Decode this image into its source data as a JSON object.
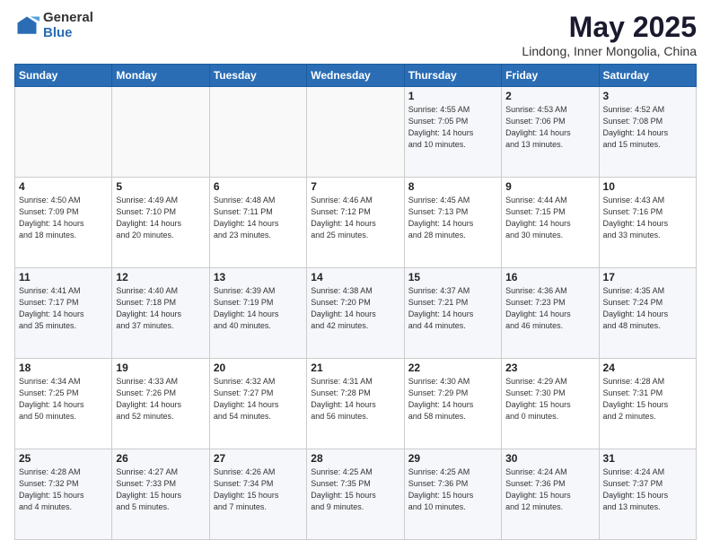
{
  "header": {
    "logo_general": "General",
    "logo_blue": "Blue",
    "month_title": "May 2025",
    "subtitle": "Lindong, Inner Mongolia, China"
  },
  "weekdays": [
    "Sunday",
    "Monday",
    "Tuesday",
    "Wednesday",
    "Thursday",
    "Friday",
    "Saturday"
  ],
  "weeks": [
    [
      {
        "day": "",
        "info": ""
      },
      {
        "day": "",
        "info": ""
      },
      {
        "day": "",
        "info": ""
      },
      {
        "day": "",
        "info": ""
      },
      {
        "day": "1",
        "info": "Sunrise: 4:55 AM\nSunset: 7:05 PM\nDaylight: 14 hours\nand 10 minutes."
      },
      {
        "day": "2",
        "info": "Sunrise: 4:53 AM\nSunset: 7:06 PM\nDaylight: 14 hours\nand 13 minutes."
      },
      {
        "day": "3",
        "info": "Sunrise: 4:52 AM\nSunset: 7:08 PM\nDaylight: 14 hours\nand 15 minutes."
      }
    ],
    [
      {
        "day": "4",
        "info": "Sunrise: 4:50 AM\nSunset: 7:09 PM\nDaylight: 14 hours\nand 18 minutes."
      },
      {
        "day": "5",
        "info": "Sunrise: 4:49 AM\nSunset: 7:10 PM\nDaylight: 14 hours\nand 20 minutes."
      },
      {
        "day": "6",
        "info": "Sunrise: 4:48 AM\nSunset: 7:11 PM\nDaylight: 14 hours\nand 23 minutes."
      },
      {
        "day": "7",
        "info": "Sunrise: 4:46 AM\nSunset: 7:12 PM\nDaylight: 14 hours\nand 25 minutes."
      },
      {
        "day": "8",
        "info": "Sunrise: 4:45 AM\nSunset: 7:13 PM\nDaylight: 14 hours\nand 28 minutes."
      },
      {
        "day": "9",
        "info": "Sunrise: 4:44 AM\nSunset: 7:15 PM\nDaylight: 14 hours\nand 30 minutes."
      },
      {
        "day": "10",
        "info": "Sunrise: 4:43 AM\nSunset: 7:16 PM\nDaylight: 14 hours\nand 33 minutes."
      }
    ],
    [
      {
        "day": "11",
        "info": "Sunrise: 4:41 AM\nSunset: 7:17 PM\nDaylight: 14 hours\nand 35 minutes."
      },
      {
        "day": "12",
        "info": "Sunrise: 4:40 AM\nSunset: 7:18 PM\nDaylight: 14 hours\nand 37 minutes."
      },
      {
        "day": "13",
        "info": "Sunrise: 4:39 AM\nSunset: 7:19 PM\nDaylight: 14 hours\nand 40 minutes."
      },
      {
        "day": "14",
        "info": "Sunrise: 4:38 AM\nSunset: 7:20 PM\nDaylight: 14 hours\nand 42 minutes."
      },
      {
        "day": "15",
        "info": "Sunrise: 4:37 AM\nSunset: 7:21 PM\nDaylight: 14 hours\nand 44 minutes."
      },
      {
        "day": "16",
        "info": "Sunrise: 4:36 AM\nSunset: 7:23 PM\nDaylight: 14 hours\nand 46 minutes."
      },
      {
        "day": "17",
        "info": "Sunrise: 4:35 AM\nSunset: 7:24 PM\nDaylight: 14 hours\nand 48 minutes."
      }
    ],
    [
      {
        "day": "18",
        "info": "Sunrise: 4:34 AM\nSunset: 7:25 PM\nDaylight: 14 hours\nand 50 minutes."
      },
      {
        "day": "19",
        "info": "Sunrise: 4:33 AM\nSunset: 7:26 PM\nDaylight: 14 hours\nand 52 minutes."
      },
      {
        "day": "20",
        "info": "Sunrise: 4:32 AM\nSunset: 7:27 PM\nDaylight: 14 hours\nand 54 minutes."
      },
      {
        "day": "21",
        "info": "Sunrise: 4:31 AM\nSunset: 7:28 PM\nDaylight: 14 hours\nand 56 minutes."
      },
      {
        "day": "22",
        "info": "Sunrise: 4:30 AM\nSunset: 7:29 PM\nDaylight: 14 hours\nand 58 minutes."
      },
      {
        "day": "23",
        "info": "Sunrise: 4:29 AM\nSunset: 7:30 PM\nDaylight: 15 hours\nand 0 minutes."
      },
      {
        "day": "24",
        "info": "Sunrise: 4:28 AM\nSunset: 7:31 PM\nDaylight: 15 hours\nand 2 minutes."
      }
    ],
    [
      {
        "day": "25",
        "info": "Sunrise: 4:28 AM\nSunset: 7:32 PM\nDaylight: 15 hours\nand 4 minutes."
      },
      {
        "day": "26",
        "info": "Sunrise: 4:27 AM\nSunset: 7:33 PM\nDaylight: 15 hours\nand 5 minutes."
      },
      {
        "day": "27",
        "info": "Sunrise: 4:26 AM\nSunset: 7:34 PM\nDaylight: 15 hours\nand 7 minutes."
      },
      {
        "day": "28",
        "info": "Sunrise: 4:25 AM\nSunset: 7:35 PM\nDaylight: 15 hours\nand 9 minutes."
      },
      {
        "day": "29",
        "info": "Sunrise: 4:25 AM\nSunset: 7:36 PM\nDaylight: 15 hours\nand 10 minutes."
      },
      {
        "day": "30",
        "info": "Sunrise: 4:24 AM\nSunset: 7:36 PM\nDaylight: 15 hours\nand 12 minutes."
      },
      {
        "day": "31",
        "info": "Sunrise: 4:24 AM\nSunset: 7:37 PM\nDaylight: 15 hours\nand 13 minutes."
      }
    ]
  ]
}
